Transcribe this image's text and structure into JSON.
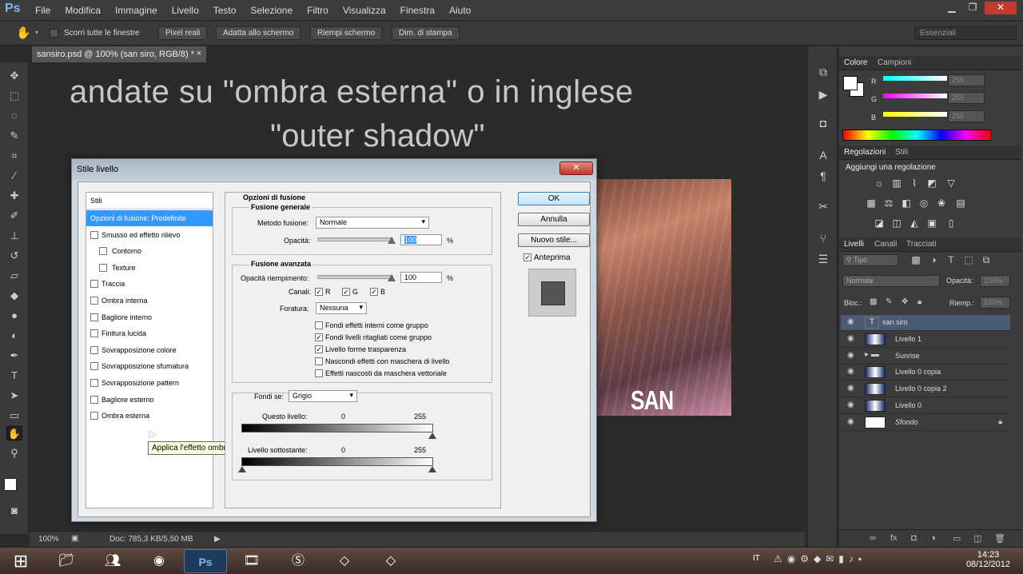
{
  "app": {
    "logo": "Ps"
  },
  "menu": [
    "File",
    "Modifica",
    "Immagine",
    "Livello",
    "Testo",
    "Selezione",
    "Filtro",
    "Visualizza",
    "Finestra",
    "Aiuto"
  ],
  "window_controls": {
    "minimize": "▁",
    "restore": "❐",
    "close": "✕"
  },
  "options_bar": {
    "scroll_all_label": "Scorri tutte le finestre",
    "buttons": [
      "Pixel reali",
      "Adatta allo schermo",
      "Riempi schermo",
      "Dim. di stampa"
    ],
    "workspace": "Essenziali"
  },
  "document_tab": {
    "title": "sansiro.psd @ 100% (san siro, RGB/8) *",
    "close": "×"
  },
  "canvas": {
    "caption_line1": "andate su \"ombra esterna\" o in inglese",
    "caption_line2": "\"outer shadow\"",
    "photo_text": "SAN SIRO"
  },
  "status_bar": {
    "zoom": "100%",
    "doc_info": "Doc: 785,3 KB/5,50 MB"
  },
  "color_panel": {
    "tabs": [
      "Colore",
      "Campioni"
    ],
    "channels": [
      {
        "label": "R",
        "value": "255",
        "gradient": "#00ffff"
      },
      {
        "label": "G",
        "value": "255",
        "gradient": "#ff00ff"
      },
      {
        "label": "B",
        "value": "255",
        "gradient": "#ffff00"
      }
    ]
  },
  "adjustments_panel": {
    "tabs": [
      "Regolazioni",
      "Stili"
    ],
    "heading": "Aggiungi una regolazione"
  },
  "layers_panel": {
    "tabs": [
      "Livelli",
      "Canali",
      "Tracciati"
    ],
    "filter": "Tipo",
    "blend_mode": "Normale",
    "opacity_label": "Opacità:",
    "opacity_value": "100%",
    "lock_label": "Bloc.:",
    "fill_label": "Riemp.:",
    "fill_value": "100%",
    "layers": [
      {
        "name": "san siro",
        "selected": true,
        "type": "text"
      },
      {
        "name": "Livello 1",
        "selected": false,
        "type": "image"
      },
      {
        "name": "Sunrise",
        "selected": false,
        "type": "folder"
      },
      {
        "name": "Livello 0 copia",
        "selected": false,
        "type": "image"
      },
      {
        "name": "Livello 0 copia 2",
        "selected": false,
        "type": "image"
      },
      {
        "name": "Livello 0",
        "selected": false,
        "type": "image"
      },
      {
        "name": "Sfondo",
        "selected": false,
        "type": "background"
      }
    ]
  },
  "dialog": {
    "title": "Stile livello",
    "close": "✕",
    "styles_header": "Stili",
    "styles": [
      {
        "label": "Opzioni di fusione: Predefinite",
        "selected": true,
        "checkbox": false,
        "indent": false
      },
      {
        "label": "Smusso ed effetto rilievo",
        "selected": false,
        "checkbox": true,
        "indent": false
      },
      {
        "label": "Contorno",
        "selected": false,
        "checkbox": true,
        "indent": true
      },
      {
        "label": "Texture",
        "selected": false,
        "checkbox": true,
        "indent": true
      },
      {
        "label": "Traccia",
        "selected": false,
        "checkbox": true,
        "indent": false
      },
      {
        "label": "Ombra interna",
        "selected": false,
        "checkbox": true,
        "indent": false
      },
      {
        "label": "Bagliore interno",
        "selected": false,
        "checkbox": true,
        "indent": false
      },
      {
        "label": "Finitura lucida",
        "selected": false,
        "checkbox": true,
        "indent": false
      },
      {
        "label": "Sovrapposizione colore",
        "selected": false,
        "checkbox": true,
        "indent": false
      },
      {
        "label": "Sovrapposizione sfumatura",
        "selected": false,
        "checkbox": true,
        "indent": false
      },
      {
        "label": "Sovrapposizione pattern",
        "selected": false,
        "checkbox": true,
        "indent": false
      },
      {
        "label": "Bagliore esterno",
        "selected": false,
        "checkbox": true,
        "indent": false
      },
      {
        "label": "Ombra esterna",
        "selected": false,
        "checkbox": true,
        "indent": false
      }
    ],
    "tooltip": "Applica l'effetto ombra esterna",
    "blending_options_title": "Opzioni di fusione",
    "general": {
      "title": "Fusione generale",
      "blend_mode_label": "Metodo fusione:",
      "blend_mode_value": "Normale",
      "opacity_label": "Opacità:",
      "opacity_value": "100",
      "percent": "%"
    },
    "advanced": {
      "title": "Fusione avanzata",
      "fill_opacity_label": "Opacità riempimento:",
      "fill_opacity_value": "100",
      "percent": "%",
      "channels_label": "Canali:",
      "channels": [
        "R",
        "G",
        "B"
      ],
      "knockout_label": "Foratura:",
      "knockout_value": "Nessuna",
      "checkbox_checked": "✓",
      "options": [
        {
          "label": "Fondi effetti interni come gruppo",
          "checked": false
        },
        {
          "label": "Fondi livelli ritagliati come gruppo",
          "checked": true
        },
        {
          "label": "Livello forme trasparenza",
          "checked": true
        },
        {
          "label": "Nascondi effetti con maschera di livello",
          "checked": false
        },
        {
          "label": "Effetti nascosti da maschera vettoriale",
          "checked": false
        }
      ]
    },
    "blend_if": {
      "label": "Fondi se:",
      "value": "Grigio",
      "this_layer_label": "Questo livello:",
      "this_layer_min": "0",
      "this_layer_max": "255",
      "underlying_label": "Livello sottostante:",
      "underlying_min": "0",
      "underlying_max": "255"
    },
    "buttons": {
      "ok": "OK",
      "cancel": "Annulla",
      "new_style": "Nuovo stile..."
    },
    "preview_label": "Anteprima",
    "preview_checked": true
  },
  "taskbar": {
    "language": "IT",
    "time": "14:23",
    "date": "08/12/2012"
  },
  "colors": {
    "accent": "#3399ff",
    "layer_selected": "#4c5b74",
    "dialog_close": "#c0392b"
  }
}
